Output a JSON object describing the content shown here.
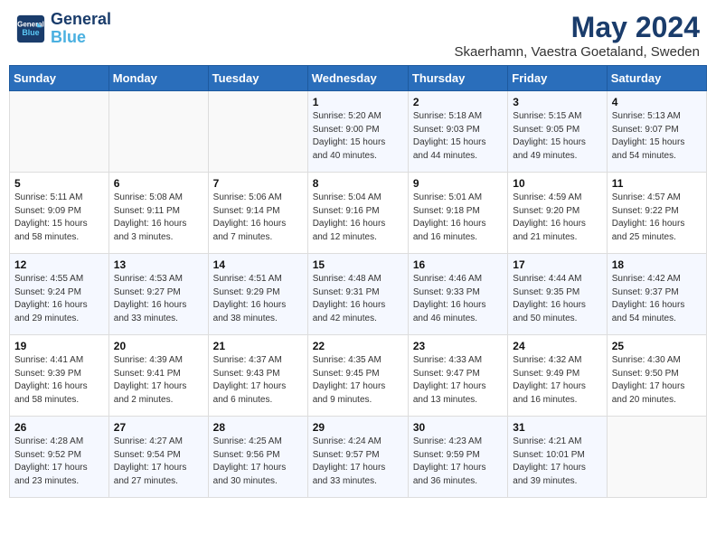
{
  "header": {
    "logo_line1": "General",
    "logo_line2": "Blue",
    "title": "May 2024",
    "subtitle": "Skaerhamn, Vaestra Goetaland, Sweden"
  },
  "weekdays": [
    "Sunday",
    "Monday",
    "Tuesday",
    "Wednesday",
    "Thursday",
    "Friday",
    "Saturday"
  ],
  "weeks": [
    [
      {
        "day": "",
        "info": ""
      },
      {
        "day": "",
        "info": ""
      },
      {
        "day": "",
        "info": ""
      },
      {
        "day": "1",
        "info": "Sunrise: 5:20 AM\nSunset: 9:00 PM\nDaylight: 15 hours\nand 40 minutes."
      },
      {
        "day": "2",
        "info": "Sunrise: 5:18 AM\nSunset: 9:03 PM\nDaylight: 15 hours\nand 44 minutes."
      },
      {
        "day": "3",
        "info": "Sunrise: 5:15 AM\nSunset: 9:05 PM\nDaylight: 15 hours\nand 49 minutes."
      },
      {
        "day": "4",
        "info": "Sunrise: 5:13 AM\nSunset: 9:07 PM\nDaylight: 15 hours\nand 54 minutes."
      }
    ],
    [
      {
        "day": "5",
        "info": "Sunrise: 5:11 AM\nSunset: 9:09 PM\nDaylight: 15 hours\nand 58 minutes."
      },
      {
        "day": "6",
        "info": "Sunrise: 5:08 AM\nSunset: 9:11 PM\nDaylight: 16 hours\nand 3 minutes."
      },
      {
        "day": "7",
        "info": "Sunrise: 5:06 AM\nSunset: 9:14 PM\nDaylight: 16 hours\nand 7 minutes."
      },
      {
        "day": "8",
        "info": "Sunrise: 5:04 AM\nSunset: 9:16 PM\nDaylight: 16 hours\nand 12 minutes."
      },
      {
        "day": "9",
        "info": "Sunrise: 5:01 AM\nSunset: 9:18 PM\nDaylight: 16 hours\nand 16 minutes."
      },
      {
        "day": "10",
        "info": "Sunrise: 4:59 AM\nSunset: 9:20 PM\nDaylight: 16 hours\nand 21 minutes."
      },
      {
        "day": "11",
        "info": "Sunrise: 4:57 AM\nSunset: 9:22 PM\nDaylight: 16 hours\nand 25 minutes."
      }
    ],
    [
      {
        "day": "12",
        "info": "Sunrise: 4:55 AM\nSunset: 9:24 PM\nDaylight: 16 hours\nand 29 minutes."
      },
      {
        "day": "13",
        "info": "Sunrise: 4:53 AM\nSunset: 9:27 PM\nDaylight: 16 hours\nand 33 minutes."
      },
      {
        "day": "14",
        "info": "Sunrise: 4:51 AM\nSunset: 9:29 PM\nDaylight: 16 hours\nand 38 minutes."
      },
      {
        "day": "15",
        "info": "Sunrise: 4:48 AM\nSunset: 9:31 PM\nDaylight: 16 hours\nand 42 minutes."
      },
      {
        "day": "16",
        "info": "Sunrise: 4:46 AM\nSunset: 9:33 PM\nDaylight: 16 hours\nand 46 minutes."
      },
      {
        "day": "17",
        "info": "Sunrise: 4:44 AM\nSunset: 9:35 PM\nDaylight: 16 hours\nand 50 minutes."
      },
      {
        "day": "18",
        "info": "Sunrise: 4:42 AM\nSunset: 9:37 PM\nDaylight: 16 hours\nand 54 minutes."
      }
    ],
    [
      {
        "day": "19",
        "info": "Sunrise: 4:41 AM\nSunset: 9:39 PM\nDaylight: 16 hours\nand 58 minutes."
      },
      {
        "day": "20",
        "info": "Sunrise: 4:39 AM\nSunset: 9:41 PM\nDaylight: 17 hours\nand 2 minutes."
      },
      {
        "day": "21",
        "info": "Sunrise: 4:37 AM\nSunset: 9:43 PM\nDaylight: 17 hours\nand 6 minutes."
      },
      {
        "day": "22",
        "info": "Sunrise: 4:35 AM\nSunset: 9:45 PM\nDaylight: 17 hours\nand 9 minutes."
      },
      {
        "day": "23",
        "info": "Sunrise: 4:33 AM\nSunset: 9:47 PM\nDaylight: 17 hours\nand 13 minutes."
      },
      {
        "day": "24",
        "info": "Sunrise: 4:32 AM\nSunset: 9:49 PM\nDaylight: 17 hours\nand 16 minutes."
      },
      {
        "day": "25",
        "info": "Sunrise: 4:30 AM\nSunset: 9:50 PM\nDaylight: 17 hours\nand 20 minutes."
      }
    ],
    [
      {
        "day": "26",
        "info": "Sunrise: 4:28 AM\nSunset: 9:52 PM\nDaylight: 17 hours\nand 23 minutes."
      },
      {
        "day": "27",
        "info": "Sunrise: 4:27 AM\nSunset: 9:54 PM\nDaylight: 17 hours\nand 27 minutes."
      },
      {
        "day": "28",
        "info": "Sunrise: 4:25 AM\nSunset: 9:56 PM\nDaylight: 17 hours\nand 30 minutes."
      },
      {
        "day": "29",
        "info": "Sunrise: 4:24 AM\nSunset: 9:57 PM\nDaylight: 17 hours\nand 33 minutes."
      },
      {
        "day": "30",
        "info": "Sunrise: 4:23 AM\nSunset: 9:59 PM\nDaylight: 17 hours\nand 36 minutes."
      },
      {
        "day": "31",
        "info": "Sunrise: 4:21 AM\nSunset: 10:01 PM\nDaylight: 17 hours\nand 39 minutes."
      },
      {
        "day": "",
        "info": ""
      }
    ]
  ]
}
